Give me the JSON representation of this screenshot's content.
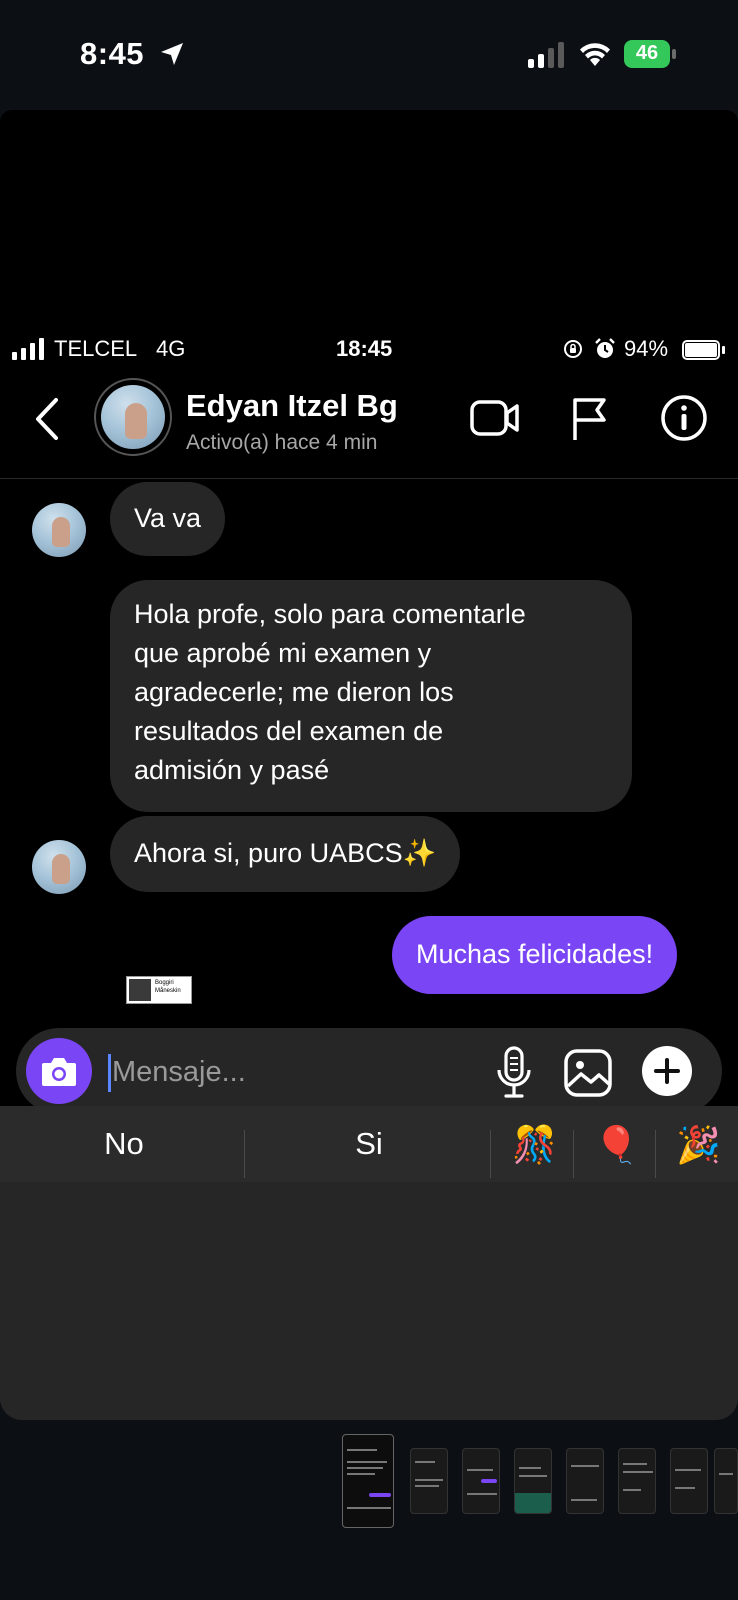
{
  "outer_status": {
    "time": "8:45",
    "battery": "46"
  },
  "inner_status": {
    "carrier": "TELCEL",
    "network": "4G",
    "time": "18:45",
    "battery_pct": "94%"
  },
  "chat_header": {
    "contact_name": "Edyan Itzel Bg",
    "status": "Activo(a) hace 4 min",
    "icons": [
      "back-chevron-icon",
      "video-call-icon",
      "flag-icon",
      "info-icon"
    ]
  },
  "messages": [
    {
      "from": "contact",
      "text": "Va va"
    },
    {
      "from": "contact",
      "lines": [
        "Hola profe, solo para comentarle",
        "que aprobé mi examen y",
        "agradecerle; me dieron los",
        "resultados del examen de",
        "admisión y pasé"
      ]
    },
    {
      "from": "contact",
      "text": "Ahora si, puro UABCS✨"
    },
    {
      "from": "me",
      "text": "Muchas felicidades!"
    }
  ],
  "sticker": {
    "line1": "Boggiri",
    "line2": "Måneskin"
  },
  "composer": {
    "placeholder": "Mensaje..."
  },
  "suggestions": {
    "word1": "No",
    "word2": "Si",
    "emoji1": "🎊",
    "emoji2": "🎈",
    "emoji3": "🎉"
  },
  "colors": {
    "accent": "#7a45f5",
    "bubble_incoming": "#262626",
    "battery_green": "#34c759"
  }
}
